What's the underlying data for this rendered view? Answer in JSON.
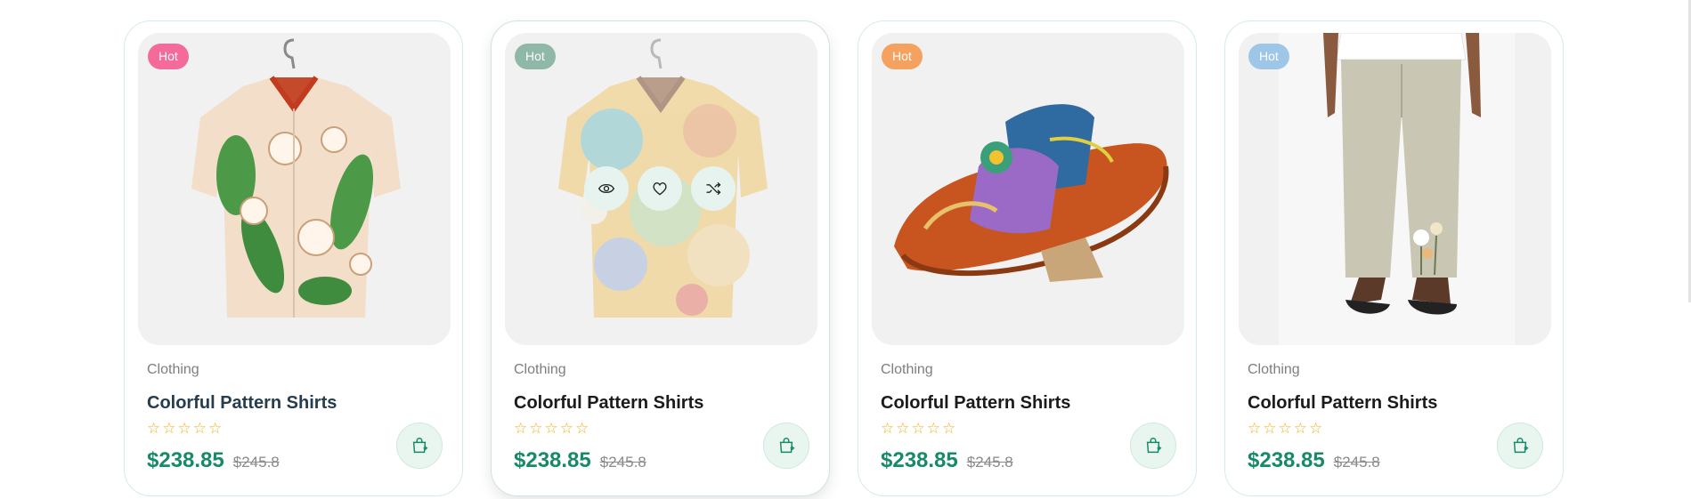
{
  "colors": {
    "accent": "#178a6a",
    "badge_pink": "#f36a9b",
    "badge_green": "#8fb8a8",
    "badge_orange": "#f5a160",
    "badge_blue": "#9ec6e6",
    "star": "#f2b01e"
  },
  "products": [
    {
      "badge": "Hot",
      "category": "Clothing",
      "title": "Colorful Pattern Shirts",
      "rating_stars": "☆☆☆☆☆",
      "rating": 0,
      "price": "$238.85",
      "old_price": "$245.8",
      "image": "floral-shirt",
      "cart_icon": "add-to-cart-icon"
    },
    {
      "badge": "Hot",
      "category": "Clothing",
      "title": "Colorful Pattern Shirts",
      "rating_stars": "☆☆☆☆☆",
      "rating": 0,
      "price": "$238.85",
      "old_price": "$245.8",
      "image": "abstract-shirt",
      "cart_icon": "add-to-cart-icon",
      "actions": [
        "eye-icon",
        "heart-icon",
        "shuffle-icon"
      ]
    },
    {
      "badge": "Hot",
      "category": "Clothing",
      "title": "Colorful Pattern Shirts",
      "rating_stars": "☆☆☆☆☆",
      "rating": 0,
      "price": "$238.85",
      "old_price": "$245.8",
      "image": "patterned-sandal",
      "cart_icon": "add-to-cart-icon"
    },
    {
      "badge": "Hot",
      "category": "Clothing",
      "title": "Colorful Pattern Shirts",
      "rating_stars": "☆☆☆☆☆",
      "rating": 0,
      "price": "$238.85",
      "old_price": "$245.8",
      "image": "linen-pants",
      "cart_icon": "add-to-cart-icon"
    }
  ]
}
